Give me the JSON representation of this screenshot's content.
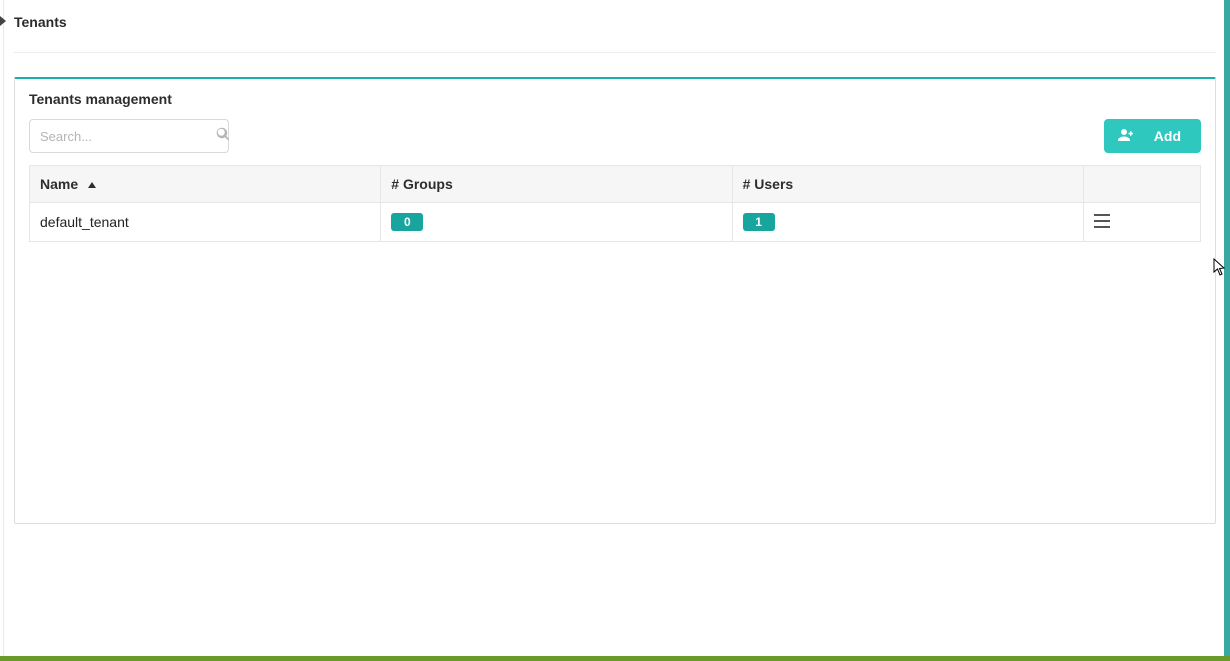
{
  "breadcrumb": {
    "title": "Tenants"
  },
  "panel": {
    "title": "Tenants management",
    "search": {
      "placeholder": "Search..."
    },
    "add_button_label": "Add"
  },
  "table": {
    "columns": {
      "name": "Name",
      "groups": "# Groups",
      "users": "# Users"
    },
    "rows": [
      {
        "name": "default_tenant",
        "groups": "0",
        "users": "1"
      }
    ]
  }
}
